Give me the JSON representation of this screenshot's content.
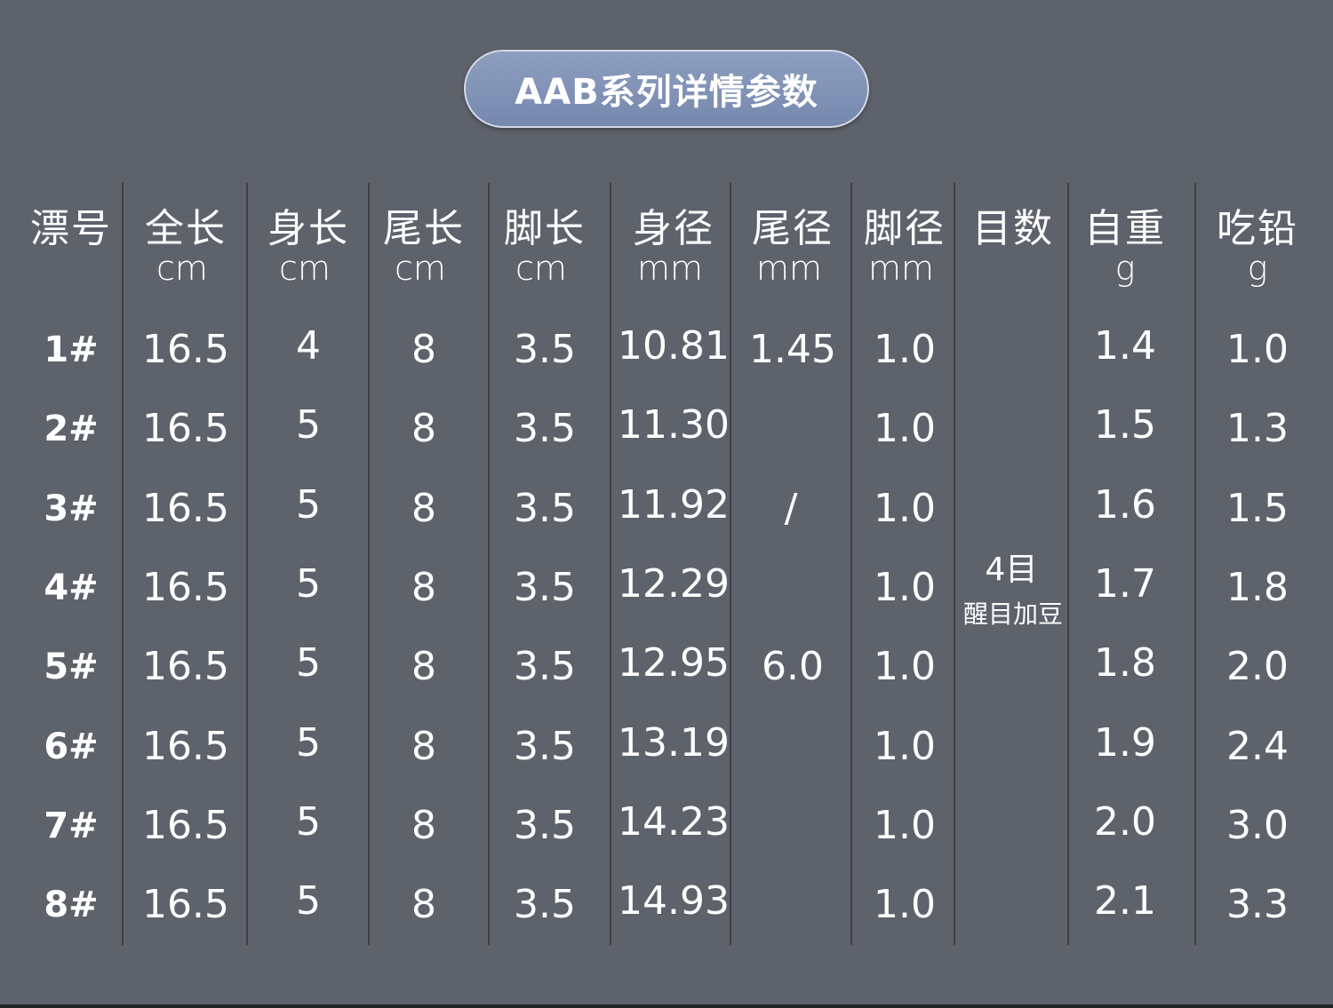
{
  "title": "AAB系列详情参数",
  "columns": [
    {
      "key": "size",
      "label": "漂号",
      "unit": ""
    },
    {
      "key": "total",
      "label": "全长",
      "unit": "cm"
    },
    {
      "key": "body",
      "label": "身长",
      "unit": "cm"
    },
    {
      "key": "tail",
      "label": "尾长",
      "unit": "cm"
    },
    {
      "key": "foot",
      "label": "脚长",
      "unit": "cm"
    },
    {
      "key": "body_d",
      "label": "身径",
      "unit": "mm"
    },
    {
      "key": "tail_d",
      "label": "尾径",
      "unit": "mm"
    },
    {
      "key": "foot_d",
      "label": "脚径",
      "unit": "mm"
    },
    {
      "key": "mesh",
      "label": "目数",
      "unit": ""
    },
    {
      "key": "weight",
      "label": "自重",
      "unit": "g"
    },
    {
      "key": "lead",
      "label": "吃铅",
      "unit": "g"
    }
  ],
  "rows": [
    {
      "size": "1#",
      "total": "16.5",
      "body": "4",
      "tail": "8",
      "foot": "3.5",
      "body_d": "10.81",
      "foot_d": "1.0",
      "weight": "1.4",
      "lead": "1.0"
    },
    {
      "size": "2#",
      "total": "16.5",
      "body": "5",
      "tail": "8",
      "foot": "3.5",
      "body_d": "11.30",
      "foot_d": "1.0",
      "weight": "1.5",
      "lead": "1.3"
    },
    {
      "size": "3#",
      "total": "16.5",
      "body": "5",
      "tail": "8",
      "foot": "3.5",
      "body_d": "11.92",
      "foot_d": "1.0",
      "weight": "1.6",
      "lead": "1.5"
    },
    {
      "size": "4#",
      "total": "16.5",
      "body": "5",
      "tail": "8",
      "foot": "3.5",
      "body_d": "12.29",
      "foot_d": "1.0",
      "weight": "1.7",
      "lead": "1.8"
    },
    {
      "size": "5#",
      "total": "16.5",
      "body": "5",
      "tail": "8",
      "foot": "3.5",
      "body_d": "12.95",
      "foot_d": "1.0",
      "weight": "1.8",
      "lead": "2.0"
    },
    {
      "size": "6#",
      "total": "16.5",
      "body": "5",
      "tail": "8",
      "foot": "3.5",
      "body_d": "13.19",
      "foot_d": "1.0",
      "weight": "1.9",
      "lead": "2.4"
    },
    {
      "size": "7#",
      "total": "16.5",
      "body": "5",
      "tail": "8",
      "foot": "3.5",
      "body_d": "14.23",
      "foot_d": "1.0",
      "weight": "2.0",
      "lead": "3.0"
    },
    {
      "size": "8#",
      "total": "16.5",
      "body": "5",
      "tail": "8",
      "foot": "3.5",
      "body_d": "14.93",
      "foot_d": "1.0",
      "weight": "2.1",
      "lead": "3.3"
    }
  ],
  "tail_diameter": {
    "first": "1.45",
    "middle": "/",
    "last": "6.0"
  },
  "mesh": {
    "main": "4目",
    "sub": "醒目加豆"
  },
  "colors": {
    "background": "#5e626b",
    "pill": "#7f91b5",
    "text": "#ffffff",
    "divider": "#3d4047"
  }
}
